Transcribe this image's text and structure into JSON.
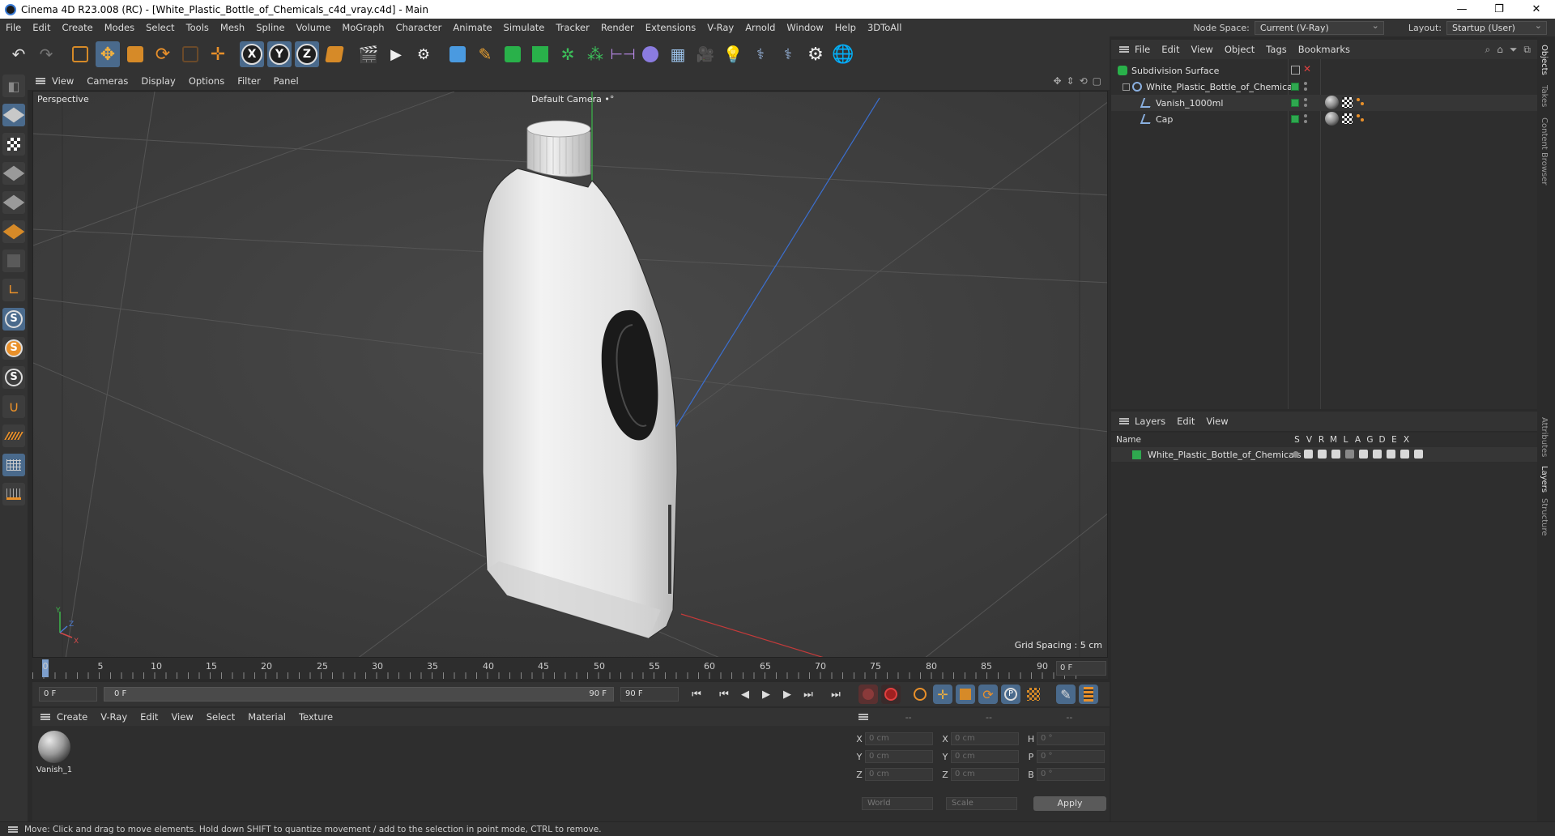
{
  "window": {
    "title": "Cinema 4D R23.008 (RC) - [White_Plastic_Bottle_of_Chemicals_c4d_vray.c4d] - Main",
    "minimize": "—",
    "maximize": "❐",
    "close": "✕"
  },
  "menubar": {
    "items": [
      "File",
      "Edit",
      "Create",
      "Modes",
      "Select",
      "Tools",
      "Mesh",
      "Spline",
      "Volume",
      "MoGraph",
      "Character",
      "Animate",
      "Simulate",
      "Tracker",
      "Render",
      "Extensions",
      "V-Ray",
      "Arnold",
      "Window",
      "Help",
      "3DToAll"
    ],
    "node_space_label": "Node Space:",
    "node_space_value": "Current (V-Ray)",
    "layout_label": "Layout:",
    "layout_value": "Startup (User)"
  },
  "toolbar": {
    "axis_x": "X",
    "axis_y": "Y",
    "axis_z": "Z"
  },
  "left_tools": {
    "s_label": "S"
  },
  "viewport": {
    "menu": [
      "View",
      "Cameras",
      "Display",
      "Options",
      "Filter",
      "Panel"
    ],
    "label": "Perspective",
    "camera": "Default Camera",
    "camera_icon": "•°",
    "grid_spacing": "Grid Spacing : 5 cm",
    "axis_y": "Y",
    "axis_z": "Z",
    "axis_x": "X"
  },
  "timeline": {
    "ticks": [
      "0",
      "5",
      "10",
      "15",
      "20",
      "25",
      "30",
      "35",
      "40",
      "45",
      "50",
      "55",
      "60",
      "65",
      "70",
      "75",
      "80",
      "85",
      "90"
    ],
    "current_frame": "0 F",
    "start_frame": "0 F",
    "range_start": "0 F",
    "range_end": "90 F",
    "end_frame": "90 F"
  },
  "material_manager": {
    "menu": [
      "Create",
      "V-Ray",
      "Edit",
      "View",
      "Select",
      "Material",
      "Texture"
    ],
    "materials": [
      {
        "name": "Vanish_1"
      }
    ]
  },
  "coordinates": {
    "headers": [
      "--",
      "--",
      "--"
    ],
    "rows": [
      {
        "a1": "X",
        "v1": "0 cm",
        "a2": "X",
        "v2": "0 cm",
        "a3": "H",
        "v3": "0 °"
      },
      {
        "a1": "Y",
        "v1": "0 cm",
        "a2": "Y",
        "v2": "0 cm",
        "a3": "P",
        "v3": "0 °"
      },
      {
        "a1": "Z",
        "v1": "0 cm",
        "a2": "Z",
        "v2": "0 cm",
        "a3": "B",
        "v3": "0 °"
      }
    ],
    "space": "World",
    "mode": "Scale",
    "apply": "Apply"
  },
  "object_manager": {
    "menu": [
      "File",
      "Edit",
      "View",
      "Object",
      "Tags",
      "Bookmarks"
    ],
    "objects": [
      {
        "name": "Subdivision Surface",
        "indent": 0
      },
      {
        "name": "White_Plastic_Bottle_of_Chemicals",
        "indent": 1
      },
      {
        "name": "Vanish_1000ml",
        "indent": 2
      },
      {
        "name": "Cap",
        "indent": 2
      }
    ]
  },
  "layer_manager": {
    "menu": [
      "Layers",
      "Edit",
      "View"
    ],
    "col_name": "Name",
    "cols": [
      "S",
      "V",
      "R",
      "M",
      "L",
      "A",
      "G",
      "D",
      "E",
      "X"
    ],
    "layers": [
      {
        "name": "White_Plastic_Bottle_of_Chemicals"
      }
    ]
  },
  "side_tabs": [
    "Objects",
    "Takes",
    "Content Browser",
    "Attributes",
    "Layers",
    "Structure"
  ],
  "status": {
    "text": "Move: Click and drag to move elements. Hold down SHIFT to quantize movement / add to the selection in point mode, CTRL to remove."
  },
  "colors": {
    "accent_active": "#4a6a8c",
    "layer_green": "#2fa84f",
    "tool_orange": "#d68a28"
  }
}
